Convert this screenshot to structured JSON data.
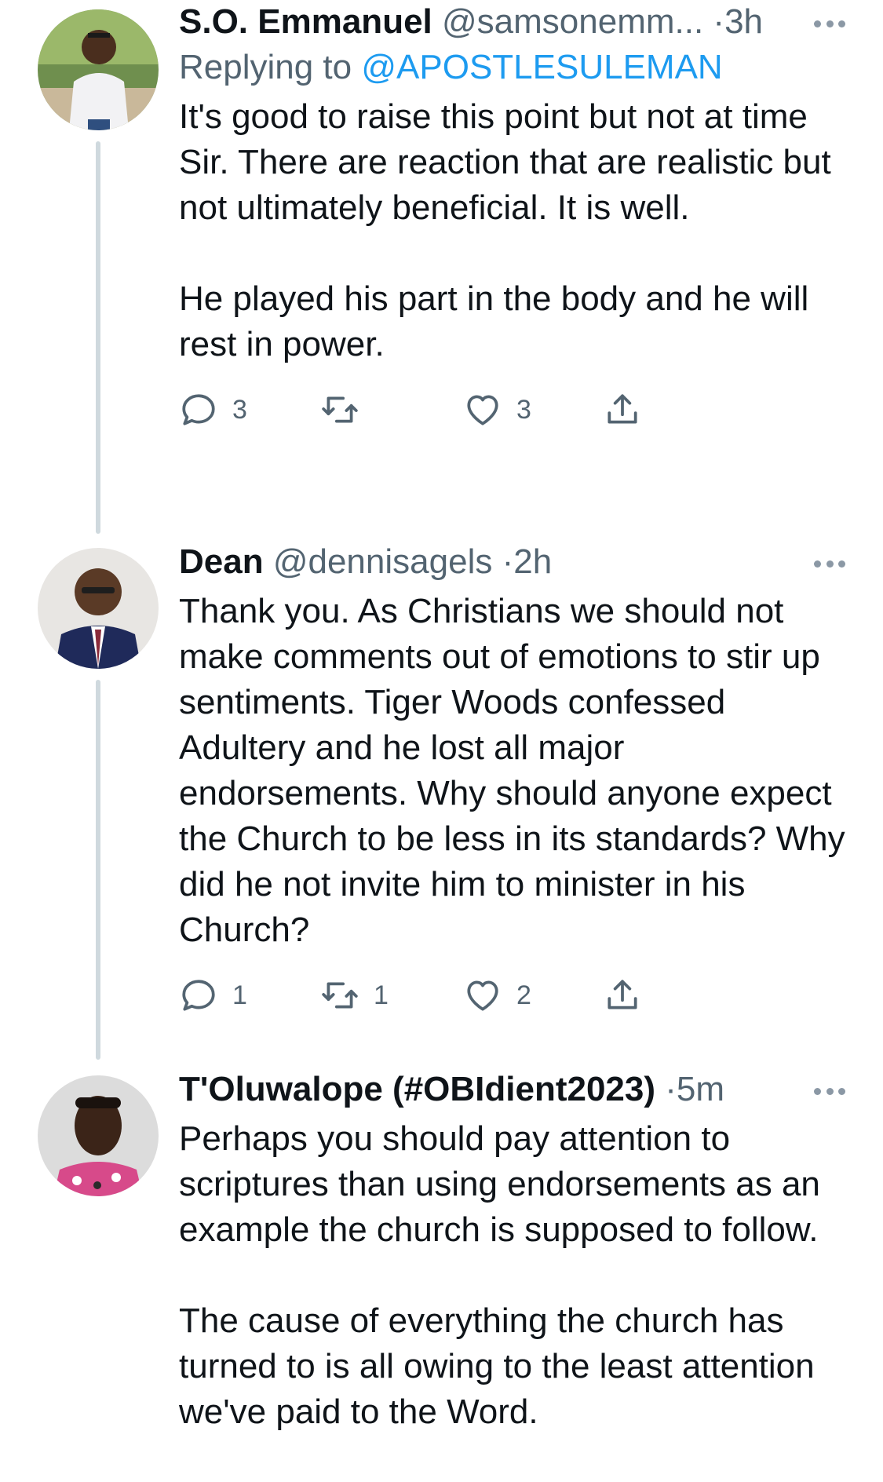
{
  "colors": {
    "link": "#1d9bf0",
    "secondary_text": "#536471",
    "thread_line": "#cfd9de"
  },
  "tweets": [
    {
      "name": "S.O. Emmanuel",
      "handle": "@samsonemm...",
      "dot": "·",
      "time": "3h",
      "replying_prefix": "Replying to ",
      "replying_to": "@APOSTLESULEMAN",
      "paragraphs": [
        "It's good to raise this point but not at time Sir. There are reaction that are realistic but not ultimately beneficial. It is well.",
        "He played his part in the body and he will rest in power."
      ],
      "reply_count": "3",
      "retweet_count": "",
      "like_count": "3"
    },
    {
      "name": "Dean",
      "handle": "@dennisagels",
      "dot": "·",
      "time": "2h",
      "paragraphs": [
        "Thank you. As Christians we should not make comments out of emotions to stir up sentiments. Tiger Woods confessed Adultery and he lost all major endorsements. Why should anyone expect the Church to be less in its standards? Why did he not invite him to minister in his Church?"
      ],
      "reply_count": "1",
      "retweet_count": "1",
      "like_count": "2"
    },
    {
      "name": "T'Oluwalope (#OBIdient2023)",
      "handle": "",
      "dot": "·",
      "time": "5m",
      "paragraphs": [
        "Perhaps you should pay attention to scriptures than using endorsements as an example the church is supposed to follow.",
        "The cause of everything the church has turned to is all owing to the least attention we've paid to the Word."
      ]
    }
  ]
}
